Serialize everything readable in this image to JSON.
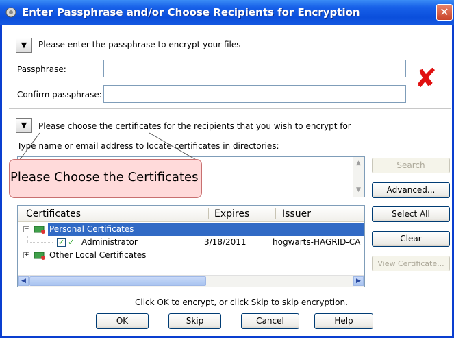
{
  "window": {
    "title": "Enter Passphrase and/or Choose Recipients for Encryption",
    "close_glyph": "✕"
  },
  "passphrase_section": {
    "toggle_glyph": "▼",
    "header": "Please enter the passphrase to encrypt your files",
    "passphrase_label": "Passphrase:",
    "passphrase_value": "",
    "confirm_label": "Confirm passphrase:",
    "confirm_value": "",
    "status_mark": "✘"
  },
  "certificate_section": {
    "toggle_glyph": "▼",
    "header": "Please choose the certificates for the recipients that you wish to encrypt for",
    "directory_label": "Type name or email address to locate certificates in directories:",
    "directory_value": ""
  },
  "callout": {
    "text": "Please Choose the Certificates"
  },
  "buttons": {
    "search": "Search",
    "advanced": "Advanced...",
    "select_all": "Select All",
    "clear": "Clear",
    "view_certificate": "View Certificate..."
  },
  "certificates_table": {
    "columns": [
      "Certificates",
      "Expires",
      "Issuer"
    ],
    "rows": [
      {
        "name": "Personal Certificates",
        "expires": "",
        "issuer": "",
        "expander": "−",
        "selected": true
      },
      {
        "name": "Administrator",
        "expires": "3/18/2011",
        "issuer": "hogwarts-HAGRID-CA",
        "checked": true
      },
      {
        "name": "Other Local Certificates",
        "expires": "",
        "issuer": "",
        "expander": "+"
      }
    ]
  },
  "footer": {
    "instruction": "Click OK to encrypt, or click Skip to skip encryption.",
    "ok": "OK",
    "skip": "Skip",
    "cancel": "Cancel",
    "help": "Help"
  },
  "colors": {
    "titlebar": "#0b4fdc",
    "selection": "#316ac5",
    "error_mark": "#e01010"
  }
}
